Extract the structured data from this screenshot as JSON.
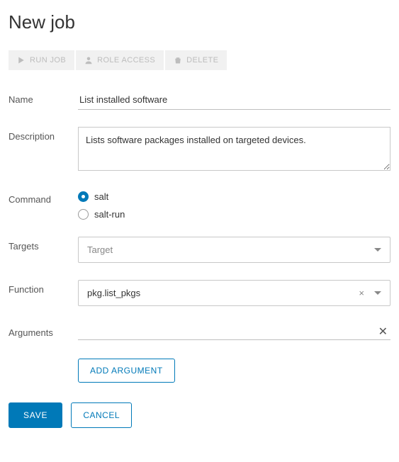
{
  "page": {
    "title": "New job"
  },
  "toolbar": {
    "run_job_label": "RUN JOB",
    "role_access_label": "ROLE ACCESS",
    "delete_label": "DELETE"
  },
  "labels": {
    "name": "Name",
    "description": "Description",
    "command": "Command",
    "targets": "Targets",
    "function": "Function",
    "arguments": "Arguments"
  },
  "form": {
    "name_value": "List installed software",
    "description_value": "Lists software packages installed on targeted devices.",
    "command_options": {
      "salt": "salt",
      "salt_run": "salt-run"
    },
    "command_selected": "salt",
    "targets_placeholder": "Target",
    "function_value": "pkg.list_pkgs"
  },
  "buttons": {
    "add_argument": "ADD ARGUMENT",
    "save": "SAVE",
    "cancel": "CANCEL"
  }
}
